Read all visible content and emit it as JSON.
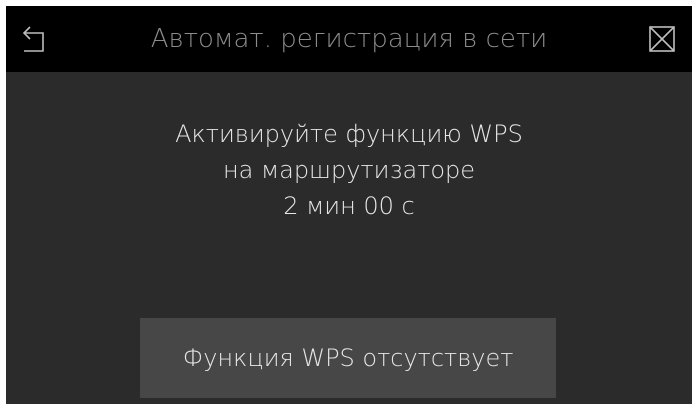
{
  "header": {
    "title": "Автомат. регистрация в сети",
    "back_icon": "back-arrow-icon",
    "close_icon": "close-icon"
  },
  "message": {
    "line1": "Активируйте функцию WPS",
    "line2": "на маршрутизаторе",
    "countdown": "2 мин 00 с"
  },
  "actions": {
    "no_wps_label": "Функция WPS отсутствует"
  },
  "colors": {
    "background": "#2b2b2b",
    "titlebar": "#000000",
    "button": "#474747",
    "text": "#e6e6e6",
    "title_text": "#8c8c8c"
  }
}
